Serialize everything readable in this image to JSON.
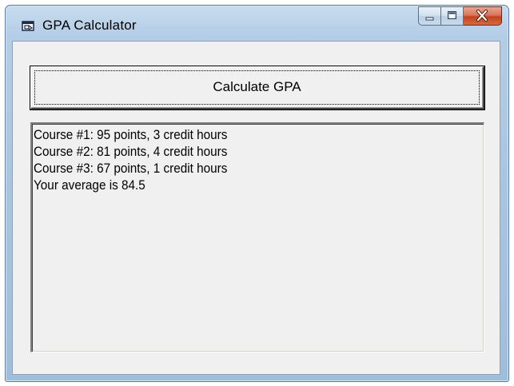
{
  "window": {
    "title": "GPA Calculator",
    "icon": "app-window-icon",
    "caption_buttons": [
      "minimize-icon",
      "maximize-icon",
      "close-icon"
    ],
    "close_color": "#c4421f"
  },
  "main": {
    "button_label": "Calculate GPA",
    "output_lines": [
      "Course #1: 95 points, 3 credit hours",
      "Course #2: 81 points, 4 credit hours",
      "Course #3: 67 points, 1 credit hours",
      "Your average is 84.5"
    ]
  }
}
